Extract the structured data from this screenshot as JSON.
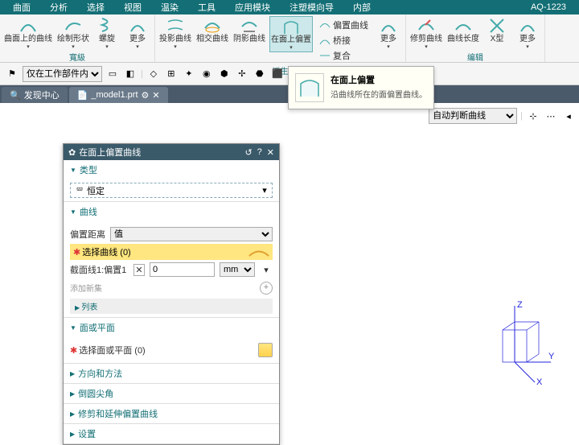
{
  "menubar": {
    "items": [
      "曲面",
      "分析",
      "选择",
      "视图",
      "温染",
      "工具",
      "应用模块",
      "注塑模向导",
      "内部"
    ],
    "code": "AQ-1223"
  },
  "ribbon": {
    "g1": {
      "items": [
        {
          "l": "曲面上的曲线"
        },
        {
          "l": "绘制形状"
        },
        {
          "l": "螺旋"
        },
        {
          "l": "更多"
        }
      ],
      "label": "寬級"
    },
    "g2": {
      "items": [
        {
          "l": "投影曲线"
        },
        {
          "l": "相交曲线"
        },
        {
          "l": "阴影曲线"
        },
        {
          "l": "在面上偏置",
          "active": true
        },
        {
          "l": "更多"
        }
      ],
      "small": [
        {
          "l": "偏置曲线"
        },
        {
          "l": "桥接"
        },
        {
          "l": "复合"
        }
      ],
      "label": "派生"
    },
    "g3": {
      "items": [
        {
          "l": "修剪曲线"
        },
        {
          "l": "曲线长度"
        },
        {
          "l": "X型"
        },
        {
          "l": "更多"
        }
      ],
      "label": "编辑"
    }
  },
  "toolbar2": {
    "filter": "仅在工作部件内"
  },
  "tabs": {
    "t1": "发现中心",
    "t2": "_model1.prt"
  },
  "rightbar": {
    "select": "自动判断曲线"
  },
  "dialog": {
    "title": "在面上偏置曲线",
    "s_type": "类型",
    "type_val": "恒定",
    "s_curve": "曲线",
    "dist_lbl": "偏置距离",
    "dist_mode": "值",
    "sel_curve": "选择曲线 (0)",
    "sec_lbl": "截面线1:偏置1",
    "sec_val": "0",
    "sec_unit": "mm",
    "add_set": "添加新集",
    "list": "列表",
    "s_face": "面或平面",
    "sel_face": "选择面或平面 (0)",
    "s_dir": "方向和方法",
    "s_corner": "倒圆尖角",
    "s_trim": "修剪和延伸偏置曲线",
    "s_set": "设置"
  },
  "tooltip": {
    "title": "在面上偏置",
    "desc": "沿曲线所在的面偏置曲线。"
  },
  "axes": {
    "x": "X",
    "y": "Y",
    "z": "Z"
  }
}
